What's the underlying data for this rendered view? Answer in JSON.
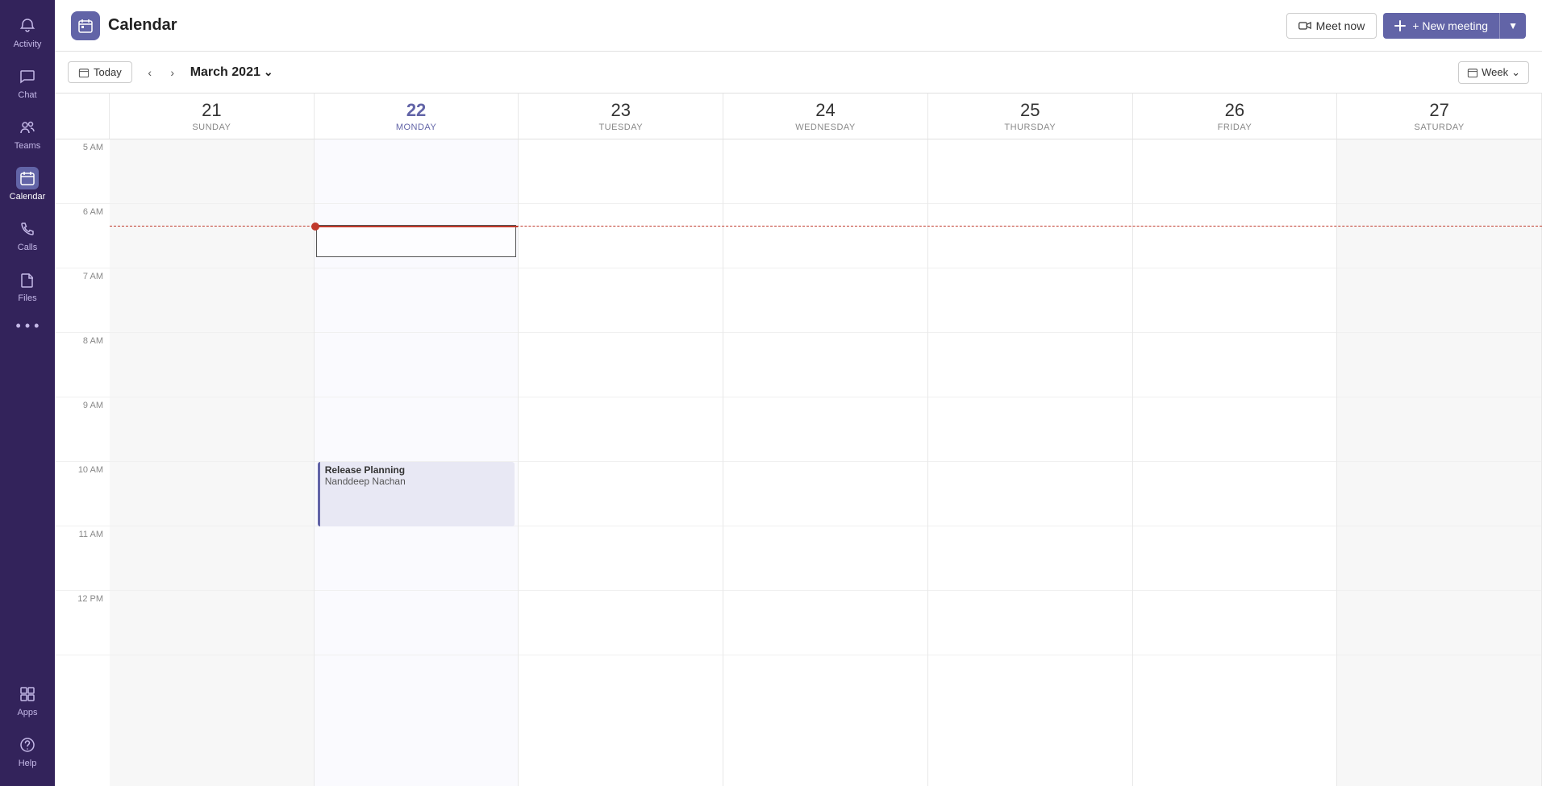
{
  "sidebar": {
    "items": [
      {
        "id": "activity",
        "label": "Activity",
        "icon": "🔔",
        "active": false
      },
      {
        "id": "chat",
        "label": "Chat",
        "icon": "💬",
        "active": false
      },
      {
        "id": "teams",
        "label": "Teams",
        "icon": "👥",
        "active": false
      },
      {
        "id": "calendar",
        "label": "Calendar",
        "icon": "📅",
        "active": true
      },
      {
        "id": "calls",
        "label": "Calls",
        "icon": "📞",
        "active": false
      },
      {
        "id": "files",
        "label": "Files",
        "icon": "📄",
        "active": false
      }
    ],
    "more_label": "•••",
    "bottom_items": [
      {
        "id": "apps",
        "label": "Apps",
        "icon": "⊞",
        "active": false
      },
      {
        "id": "help",
        "label": "Help",
        "icon": "❓",
        "active": false
      }
    ]
  },
  "topbar": {
    "title": "Calendar",
    "meet_now_label": "Meet now",
    "new_meeting_label": "+ New meeting",
    "new_meeting_chevron": "▼"
  },
  "toolbar": {
    "today_label": "Today",
    "prev_label": "‹",
    "next_label": "›",
    "month_year": "March 2021",
    "chevron": "⌄",
    "week_label": "Week",
    "week_chevron": "⌄"
  },
  "days_header": [
    {
      "num": "21",
      "name": "Sunday",
      "is_today": false,
      "is_weekend": true
    },
    {
      "num": "22",
      "name": "Monday",
      "is_today": true,
      "is_weekend": false
    },
    {
      "num": "23",
      "name": "Tuesday",
      "is_today": false,
      "is_weekend": false
    },
    {
      "num": "24",
      "name": "Wednesday",
      "is_today": false,
      "is_weekend": false
    },
    {
      "num": "25",
      "name": "Thursday",
      "is_today": false,
      "is_weekend": false
    },
    {
      "num": "26",
      "name": "Friday",
      "is_today": false,
      "is_weekend": false
    },
    {
      "num": "27",
      "name": "Saturday",
      "is_today": false,
      "is_weekend": true
    }
  ],
  "time_slots": [
    {
      "label": "5 AM",
      "id": "5am"
    },
    {
      "label": "6 AM",
      "id": "6am"
    },
    {
      "label": "7 AM",
      "id": "7am"
    },
    {
      "label": "8 AM",
      "id": "8am"
    },
    {
      "label": "9 AM",
      "id": "9am"
    },
    {
      "label": "10 AM",
      "id": "10am"
    },
    {
      "label": "11 AM",
      "id": "11am"
    },
    {
      "label": "12 PM",
      "id": "12pm"
    }
  ],
  "events": [
    {
      "id": "release-planning",
      "title": "Release Planning",
      "subtitle": "Nanddeep Nachan",
      "day_index": 1,
      "top_slots_from_5am": 5,
      "duration_slots": 0.5,
      "color_bg": "#e8e8f4",
      "color_border": "#6264a7"
    }
  ],
  "current_time": {
    "label": "6:20 AM",
    "slot_offset": 1.33
  }
}
